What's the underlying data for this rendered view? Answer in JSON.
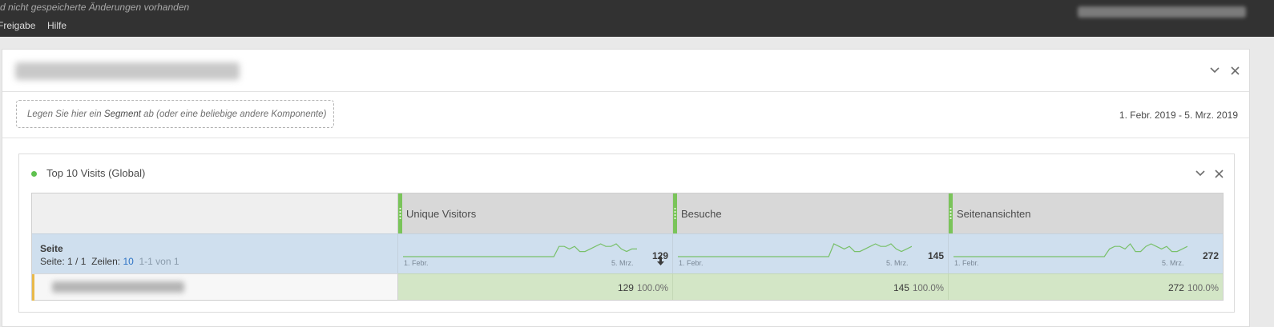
{
  "topbar": {
    "unsaved_text": "d nicht gespeicherte Änderungen vorhanden",
    "menu": [
      "Freigabe",
      "Hilfe"
    ]
  },
  "panel": {
    "segment_dropzone": {
      "prefix": "Legen Sie hier ein ",
      "keyword": "Segment",
      "suffix": " ab (oder eine beliebige andere Komponente)"
    },
    "date_range": "1. Febr. 2019 - 5. Mrz. 2019"
  },
  "table": {
    "title": "Top 10 Visits (Global)",
    "dimension": {
      "name": "Seite",
      "page_label": "Seite:",
      "page_value": "1 / 1",
      "rows_label": "Zeilen:",
      "rows_value": "10",
      "range_label": "1-1 von 1"
    },
    "metrics": [
      {
        "label": "Unique Visitors",
        "total": "129",
        "sort_icon": "arrow-down-icon",
        "start": "1. Febr.",
        "end": "5. Mrz.",
        "row_value": "129",
        "row_pct": "100.0%",
        "spark": [
          0,
          0,
          0,
          0,
          0,
          0,
          0,
          0,
          0,
          0,
          0,
          0,
          0,
          0,
          0,
          0,
          0,
          0,
          0,
          0,
          0,
          0,
          0,
          0,
          0,
          0,
          0,
          0,
          0,
          0,
          4,
          4,
          3,
          4,
          2,
          2,
          3,
          4,
          5,
          4,
          4,
          5,
          3,
          2,
          3,
          3
        ]
      },
      {
        "label": "Besuche",
        "total": "145",
        "start": "1. Febr.",
        "end": "5. Mrz.",
        "row_value": "145",
        "row_pct": "100.0%",
        "spark": [
          0,
          0,
          0,
          0,
          0,
          0,
          0,
          0,
          0,
          0,
          0,
          0,
          0,
          0,
          0,
          0,
          0,
          0,
          0,
          0,
          0,
          0,
          0,
          0,
          0,
          0,
          0,
          0,
          0,
          0,
          5,
          4,
          3,
          4,
          2,
          2,
          3,
          4,
          5,
          4,
          4,
          5,
          3,
          2,
          3,
          4
        ]
      },
      {
        "label": "Seitenansichten",
        "total": "272",
        "start": "1. Febr.",
        "end": "5. Mrz.",
        "row_value": "272",
        "row_pct": "100.0%",
        "spark": [
          0,
          0,
          0,
          0,
          0,
          0,
          0,
          0,
          0,
          0,
          0,
          0,
          0,
          0,
          0,
          0,
          0,
          0,
          0,
          0,
          0,
          0,
          0,
          0,
          0,
          0,
          0,
          0,
          0,
          0,
          3,
          4,
          4,
          3,
          5,
          2,
          2,
          4,
          5,
          4,
          3,
          4,
          2,
          2,
          3,
          4
        ]
      }
    ]
  },
  "colors": {
    "accent_green": "#7ac45a",
    "selection_blue": "#cfdfee",
    "cell_green": "#d3e6c6"
  }
}
